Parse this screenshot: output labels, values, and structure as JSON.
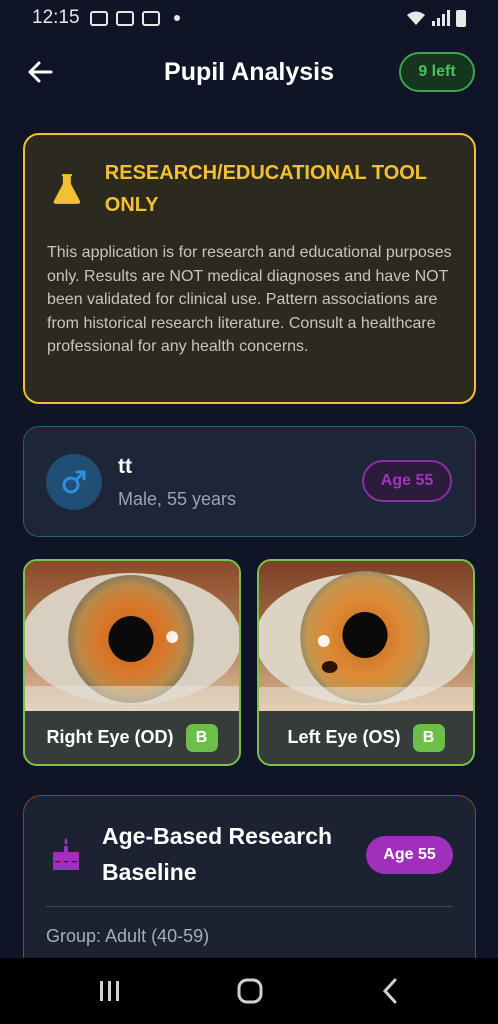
{
  "status_bar": {
    "time": "12:15"
  },
  "header": {
    "title": "Pupil Analysis",
    "quota": "9 left"
  },
  "disclaimer": {
    "title": "RESEARCH/EDUCATIONAL TOOL ONLY",
    "body": "This application is for research and educational purposes only. Results are NOT medical diagnoses and have NOT been validated for clinical use. Pattern associations are from historical research literature. Consult a healthcare professional for any health concerns.",
    "border_color": "#f0c030"
  },
  "patient": {
    "name": "tt",
    "details": "Male, 55 years",
    "age_badge": "Age 55",
    "gender_icon": "male-symbol-icon"
  },
  "eyes": [
    {
      "label": "Right Eye (OD)",
      "grade": "B"
    },
    {
      "label": "Left Eye (OS)",
      "grade": "B"
    }
  ],
  "baseline": {
    "title": "Age-Based Research Baseline",
    "age_badge": "Age 55",
    "group": "Group: Adult (40-59)"
  },
  "colors": {
    "background": "#0f1526",
    "accent_green": "#6cc04a",
    "accent_purple": "#a02fbc",
    "warning_yellow": "#f4c033"
  }
}
